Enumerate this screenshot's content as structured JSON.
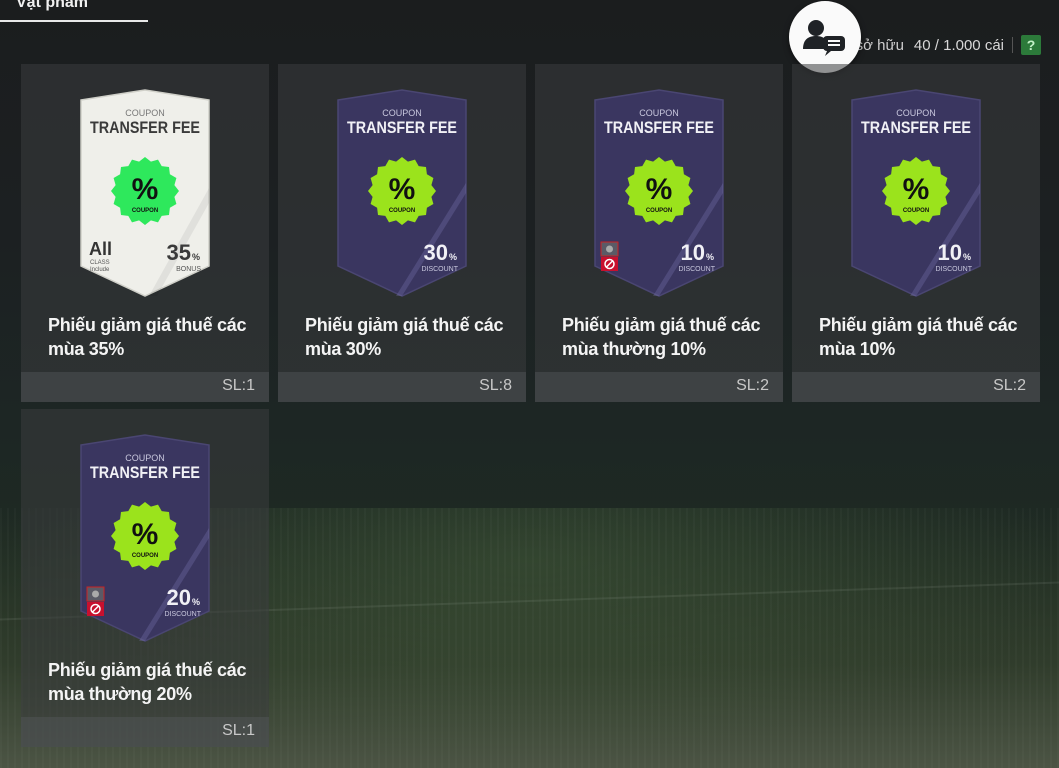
{
  "tab": {
    "label": "Vật phẩm"
  },
  "owned": {
    "label": "g sở hữu",
    "count": "40 / 1.000 cái",
    "help": "?"
  },
  "items": [
    {
      "title": "Phiếu giảm giá thuế các mùa 35%",
      "qty": "SL:1",
      "card_header": "COUPON",
      "card_title": "TRANSFER FEE",
      "badge_symbol": "%",
      "badge_text": "COUPON",
      "value": "35",
      "unit": "%",
      "value_label": "BONUS",
      "class_big": "All",
      "class_small1": "CLASS",
      "class_small2": "Include"
    },
    {
      "title": "Phiếu giảm giá thuế các mùa 30%",
      "qty": "SL:8",
      "card_header": "COUPON",
      "card_title": "TRANSFER FEE",
      "badge_symbol": "%",
      "badge_text": "COUPON",
      "value": "30",
      "unit": "%",
      "value_label": "DISCOUNT"
    },
    {
      "title": "Phiếu giảm giá thuế các mùa thường 10%",
      "qty": "SL:2",
      "card_header": "COUPON",
      "card_title": "TRANSFER FEE",
      "badge_symbol": "%",
      "badge_text": "COUPON",
      "value": "10",
      "unit": "%",
      "value_label": "DISCOUNT"
    },
    {
      "title": "Phiếu giảm giá thuế các mùa 10%",
      "qty": "SL:2",
      "card_header": "COUPON",
      "card_title": "TRANSFER FEE",
      "badge_symbol": "%",
      "badge_text": "COUPON",
      "value": "10",
      "unit": "%",
      "value_label": "DISCOUNT"
    },
    {
      "title": "Phiếu giảm giá thuế các mùa thường 20%",
      "qty": "SL:1",
      "card_header": "COUPON",
      "card_title": "TRANSFER FEE",
      "badge_symbol": "%",
      "badge_text": "COUPON",
      "value": "20",
      "unit": "%",
      "value_label": "DISCOUNT"
    }
  ],
  "colors": {
    "badge": "#9be31c",
    "badge_alt": "#2ee85c",
    "card_dark": "#3a3660",
    "card_light": "#efefea"
  },
  "icons": {
    "chat": "user-chat-icon",
    "restricted": "no-entry-icon"
  }
}
